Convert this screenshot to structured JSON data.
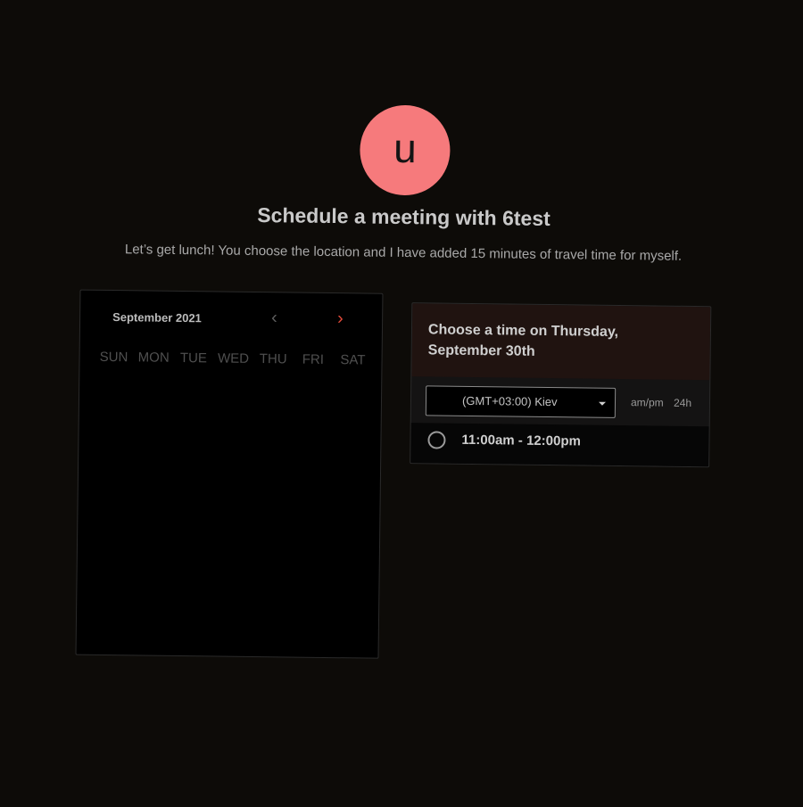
{
  "host": {
    "avatar_initial": "u",
    "avatar_color": "#f67a7c"
  },
  "header": {
    "title": "Schedule a meeting with 6test",
    "description": "Let’s get lunch! You choose the location and I have added 15 minutes of travel time for myself."
  },
  "calendar": {
    "month_label": "September 2021",
    "prev_icon": "chevron-left-icon",
    "next_icon": "chevron-right-icon",
    "prev_glyph": "‹",
    "next_glyph": "›",
    "accent_color": "#e24a3a",
    "weekdays": [
      "SUN",
      "MON",
      "TUE",
      "WED",
      "THU",
      "FRI",
      "SAT"
    ]
  },
  "time_panel": {
    "heading": "Choose a time on Thursday, September 30th",
    "timezone": "(GMT+03:00) Kiev",
    "format_options": [
      "am/pm",
      "24h"
    ],
    "slots": [
      "11:00am - 12:00pm"
    ]
  }
}
